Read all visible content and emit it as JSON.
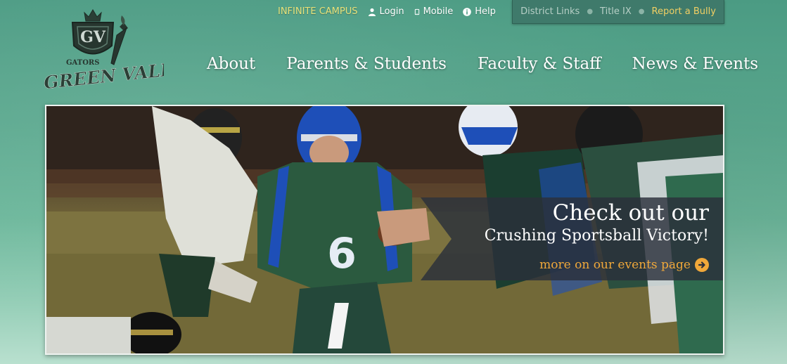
{
  "utility": {
    "campus_label": "INFINITE CAMPUS",
    "login_label": "Login",
    "mobile_label": "Mobile",
    "help_label": "Help"
  },
  "district": {
    "links_label": "District Links",
    "title_ix_label": "Title IX",
    "bully_label": "Report a Bully"
  },
  "logo": {
    "top_text": "GATORS",
    "main_text": "GREEN VALLEY"
  },
  "nav": {
    "items": [
      {
        "label": "About"
      },
      {
        "label": "Parents & Students"
      },
      {
        "label": "Faculty & Staff"
      },
      {
        "label": "News & Events"
      }
    ]
  },
  "hero": {
    "title": "Check out our",
    "subtitle": "Crushing Sportsball Victory!",
    "link_label": "more on our events page"
  },
  "colors": {
    "accent_orange": "#f0a83a",
    "campus_yellow": "#e8e27a",
    "bully_yellow": "#f1cf63",
    "teal": "#4b9b83"
  }
}
